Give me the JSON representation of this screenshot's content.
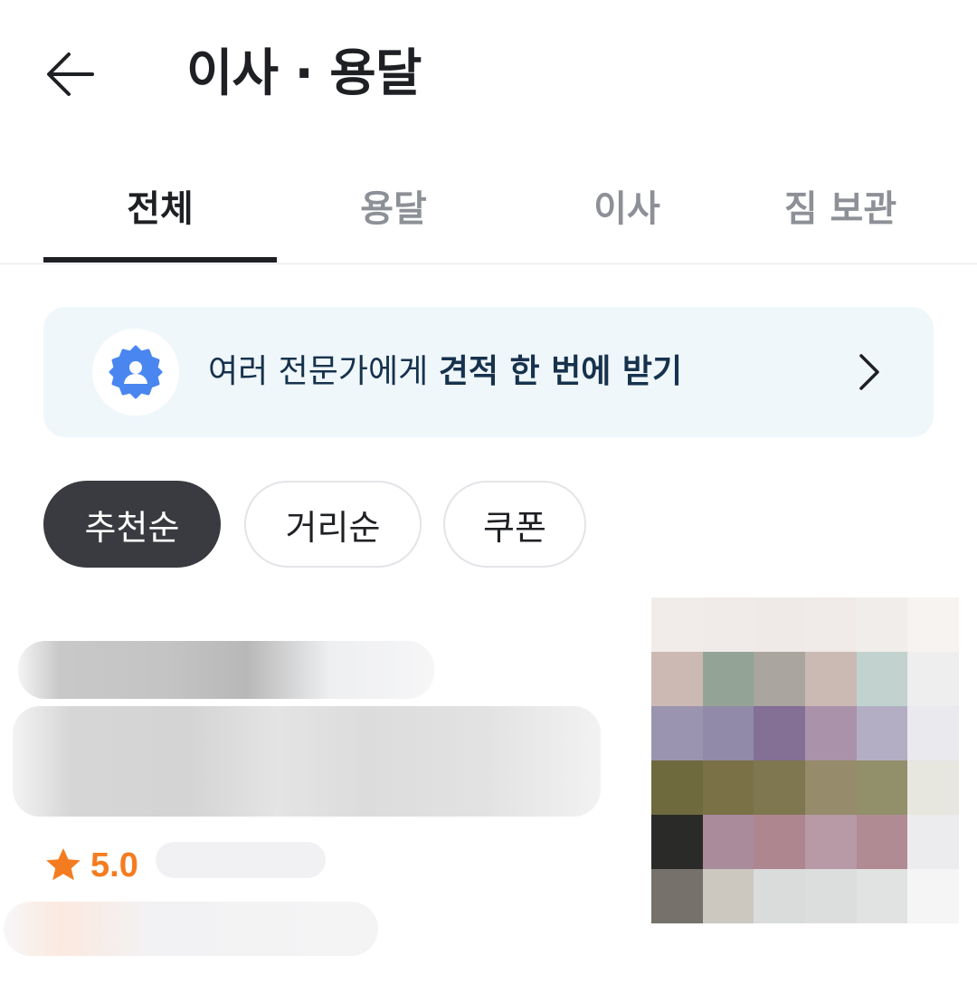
{
  "header": {
    "back_icon": "arrow-left-icon",
    "title": "이사 · 용달"
  },
  "tabs": [
    {
      "label": "전체",
      "active": true
    },
    {
      "label": "용달",
      "active": false
    },
    {
      "label": "이사",
      "active": false
    },
    {
      "label": "짐 보관",
      "active": false
    }
  ],
  "banner": {
    "icon": "expert-badge-icon",
    "text_regular": "여러 전문가에게 ",
    "text_bold": "견적 한 번에 받기",
    "chevron_icon": "chevron-right-icon"
  },
  "sort_chips": [
    {
      "label": "추천순",
      "active": true
    },
    {
      "label": "거리순",
      "active": false
    },
    {
      "label": "쿠폰",
      "active": false
    }
  ],
  "listing": {
    "rating": "5.0",
    "rating_icon": "star-icon"
  },
  "colors": {
    "accent_orange": "#f47c20",
    "banner_bg": "#eff7fb",
    "badge_blue": "#4a86ef",
    "chip_active_bg": "#3a3b40"
  }
}
